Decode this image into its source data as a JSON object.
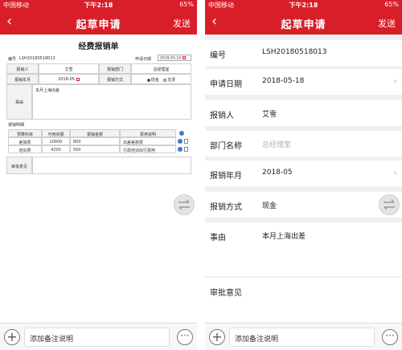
{
  "status": {
    "carrier": "中国移动",
    "time": "下午2:18",
    "battery": "65%"
  },
  "nav": {
    "back": "‹",
    "title": "起草申请",
    "send": "发送"
  },
  "toolbar": {
    "plus": "+",
    "note": "添加备注说明",
    "more": "···"
  },
  "form": {
    "title": "经费报销单",
    "no_label": "编号",
    "no_value": "LSH20180518013",
    "apply_date_label": "申请日期",
    "apply_date_value": "2018-05-18",
    "applicant_label": "报销人",
    "applicant_value": "艾雪",
    "dept_label": "报销部门",
    "dept_value": "总经理室",
    "month_label": "报销年月",
    "month_value": "2018-05",
    "method_label": "报销方式",
    "method_cash": "现金",
    "method_bank": "支票",
    "reason_label": "事由",
    "reason_value": "本月上海出差",
    "detail_label": "报销明细",
    "detail_headers": [
      "预算科目",
      "可用余额",
      "报销金额",
      "费用说明"
    ],
    "detail_rows": [
      {
        "subject": "差旅费",
        "balance": "10000",
        "amount": "800",
        "desc": "出差差旅费"
      },
      {
        "subject": "培训费",
        "balance": "4200",
        "amount": "500",
        "desc": "行政培训出行费用"
      }
    ],
    "approval_label": "审批意见"
  },
  "list": {
    "no_label": "编号",
    "no_value": "LSH20180518013",
    "apply_date_label": "申请日期",
    "apply_date_value": "2018-05-18",
    "applicant_label": "报销人",
    "applicant_value": "艾雪",
    "dept_label": "部门名称",
    "dept_placeholder": "总经理室",
    "month_label": "报销年月",
    "month_value": "2018-05",
    "method_label": "报销方式",
    "method_value": "现金",
    "reason_label": "事由",
    "reason_value": "本月上海出差",
    "approval_label": "审批意见"
  },
  "colors": {
    "brand_red": "#d81e29",
    "accent_blue": "#3a7bd5"
  }
}
